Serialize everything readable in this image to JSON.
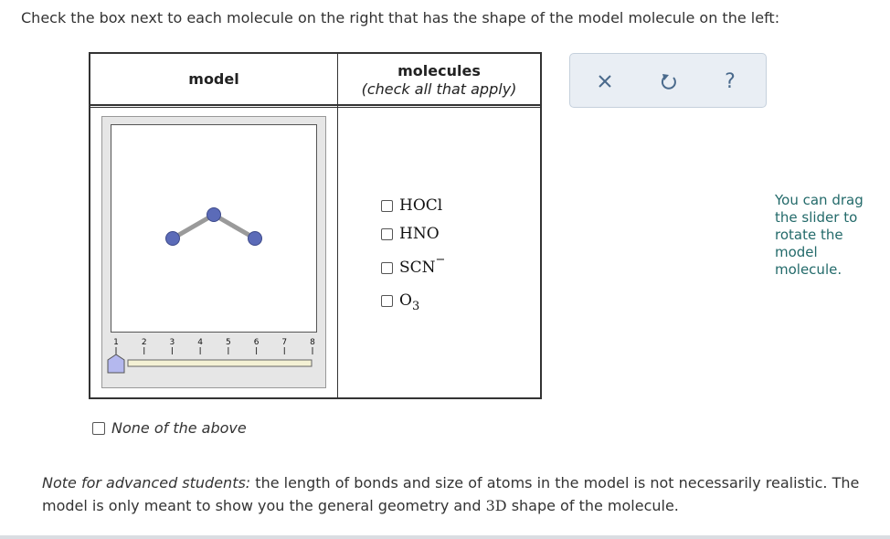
{
  "prompt": "Check the box next to each molecule on the right that has the shape of the model molecule on the left:",
  "table": {
    "model_header": "model",
    "molecules_header": "molecules",
    "molecules_subheader": "(check all that apply)"
  },
  "slider": {
    "ticks": [
      "1",
      "2",
      "3",
      "4",
      "5",
      "6",
      "7",
      "8"
    ],
    "value": 1
  },
  "choices": [
    {
      "formula": "HOCl",
      "checked": false
    },
    {
      "formula": "HNO",
      "checked": false
    },
    {
      "formula": "SCN",
      "charge": "−",
      "checked": false
    },
    {
      "formula": "O",
      "subscript": "3",
      "checked": false
    }
  ],
  "none_of_the_above": "None of the above",
  "toolbar": {
    "close_icon": "close-icon",
    "undo_icon": "undo-icon",
    "help_label": "?"
  },
  "hint": "You can drag the slider to rotate the model molecule.",
  "note": {
    "lead": "Note for advanced students:",
    "text_1": "the length of bonds and size of atoms in the model is not necessarily realistic. The model is only meant to show you the general geometry and",
    "three_d": "3D",
    "text_2": "shape of the molecule."
  },
  "colors": {
    "atom": "#5b6bb8",
    "bond": "#aaaaaa",
    "slider_thumb": "#b4b8ee",
    "toolbar_icon": "#4a6a8c",
    "hint_text": "#236a6a"
  }
}
